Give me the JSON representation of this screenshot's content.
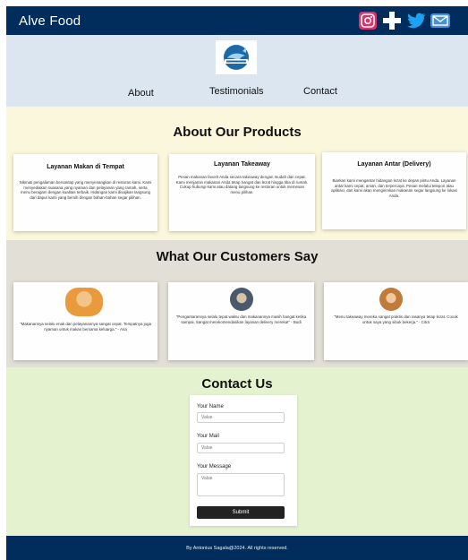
{
  "header": {
    "brand": "Alve Food",
    "socials": [
      {
        "icon": "instagram-icon",
        "color": "#e1306c"
      },
      {
        "icon": "plus-icon",
        "color": "#ffffff"
      },
      {
        "icon": "twitter-icon",
        "color": "#1da1f2"
      },
      {
        "icon": "mail-icon",
        "color": "#4a90d9"
      }
    ]
  },
  "nav": {
    "items": [
      "About",
      "Testimonials",
      "Contact"
    ]
  },
  "products": {
    "title": "About Our Products",
    "cards": [
      {
        "title": "Layanan Makan di Tempat",
        "desc": "Nikmati pengalaman bersantap yang menyenangkan di restoran kami. Kami menyediakan suasana yang nyaman dan pelayanan yang ramah, serta menu beragam dengan kualitas terbaik. Hidangan kami disajikan langsung dari dapur kami yang bersih dengan bahan-bahan segar pilihan."
      },
      {
        "title": "Layanan Takeaway",
        "desc": "Pesan makanan favorit Anda secara takeaway dengan mudah dan cepat. Kami menjamin makanan Anda tetap hangat dan lezat hingga tiba di rumah. Cukup hubungi kami atau datang langsung ke restoran untuk memesan menu pilihan."
      },
      {
        "title": "Layanan Antar (Delivery)",
        "desc": "Biarkan kami mengantar hidangan lezat ke depan pintu Anda. Layanan antar kami cepat, aman, dan terpercaya. Pesan melalui telepon atau aplikasi, dan kami akan mengirimkan makanan segar langsung ke lokasi Anda."
      }
    ]
  },
  "testimonials": {
    "title": "What Our Customers Say",
    "items": [
      {
        "quote": "\"Makanannya selalu enak dan pelayanannya sangat cepat. Tempatnya juga nyaman untuk makan bersama keluarga.\" - Ana",
        "color": "#e89a3c"
      },
      {
        "quote": "\"Pengantarannya selalu tepat waktu dan makanannya masih hangat ketika sampai. Sangat merekomendasikan layanan delivery mereka!\" - Budi",
        "color": "#4a5a6a"
      },
      {
        "quote": "\"Menu takeaway mereka sangat praktis dan rasanya tetap lezat. Cocok untuk saya yang sibuk bekerja.\" - Citra",
        "color": "#c07a3a"
      }
    ]
  },
  "contact": {
    "title": "Contact Us",
    "name_label": "Your Name",
    "name_placeholder": "Value",
    "email_label": "Your Mail",
    "email_placeholder": "Value",
    "message_label": "Your Message",
    "message_placeholder": "Value",
    "submit_label": "Submit"
  },
  "footer": {
    "text": "By Antonius Sagala@2024. All rights reserved."
  }
}
